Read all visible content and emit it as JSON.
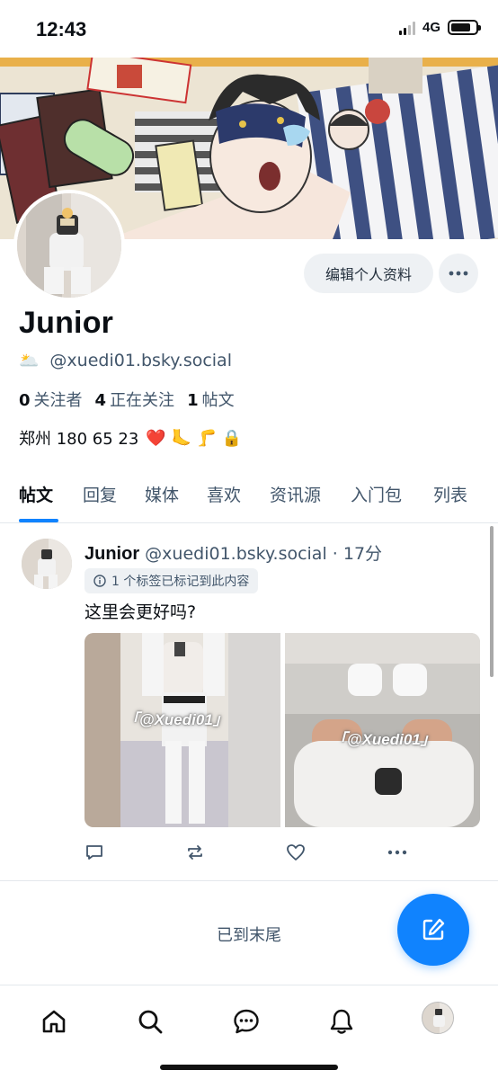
{
  "status_bar": {
    "time": "12:43",
    "network": "4G",
    "battery_level": 0.82
  },
  "profile": {
    "display_name": "Junior",
    "handle": "@xuedi01.bsky.social",
    "handle_emoji": "🌥️",
    "stats": [
      {
        "count": "0",
        "label": "关注者"
      },
      {
        "count": "4",
        "label": "正在关注"
      },
      {
        "count": "1",
        "label": "帖文"
      }
    ],
    "bio_text": "郑州 180 65 23",
    "bio_emojis": "❤️ 🦶 🦵 🔒",
    "edit_button": "编辑个人资料"
  },
  "tabs": [
    "帖文",
    "回复",
    "媒体",
    "喜欢",
    "资讯源",
    "入门包",
    "列表"
  ],
  "active_tab": 0,
  "post": {
    "author": "Junior",
    "handle": "@xuedi01.bsky.social",
    "separator": "·",
    "time": "17分",
    "label_notice": "1 个标签已标记到此内容",
    "text": "这里会更好吗?",
    "image_watermark": "「@Xuedi01」"
  },
  "feed_end_text": "已到末尾",
  "colors": {
    "accent": "#1083fe",
    "muted_text": "#42566b",
    "button_bg": "#eef1f4"
  }
}
